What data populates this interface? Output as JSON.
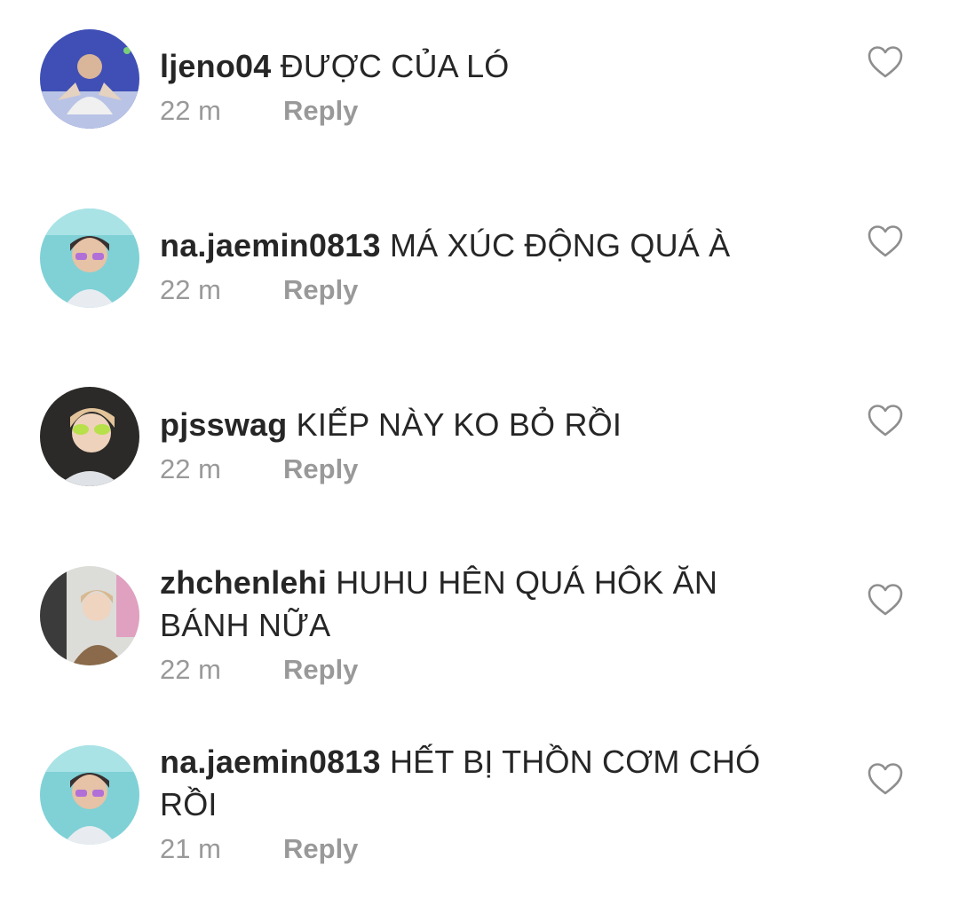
{
  "comments": [
    {
      "username": "ljeno04",
      "text": "ĐƯỢC CỦA LÓ",
      "text_line2": "",
      "time": "22 m",
      "reply_label": "Reply",
      "avatar_colors": [
        "#3f4fb5",
        "#8fa2d8"
      ]
    },
    {
      "username": "na.jaemin0813",
      "text": "MÁ XÚC ĐỘNG QUÁ À",
      "text_line2": "",
      "time": "22 m",
      "reply_label": "Reply",
      "avatar_colors": [
        "#7fd1d6",
        "#c9a0e8"
      ]
    },
    {
      "username": "pjsswag",
      "text": "KIẾP NÀY KO BỎ RỒI",
      "text_line2": "",
      "time": "22 m",
      "reply_label": "Reply",
      "avatar_colors": [
        "#2b2a28",
        "#e2c39a"
      ]
    },
    {
      "username": "zhchenlehi",
      "text": "HUHU HÊN QUÁ HÔK ĂN",
      "text_line2": "BÁNH NỮA",
      "time": "22 m",
      "reply_label": "Reply",
      "avatar_colors": [
        "#dcdcd8",
        "#8a6a4a"
      ]
    },
    {
      "username": "na.jaemin0813",
      "text": "HẾT BỊ THỒN CƠM CHÓ",
      "text_line2": "RỒI",
      "time": "21 m",
      "reply_label": "Reply",
      "avatar_colors": [
        "#7fd1d6",
        "#c9a0e8"
      ]
    }
  ],
  "colors": {
    "text": "#262626",
    "muted": "#999999",
    "heart_outline": "#8e8e8e"
  },
  "icons": {
    "like": "heart-outline-icon"
  }
}
